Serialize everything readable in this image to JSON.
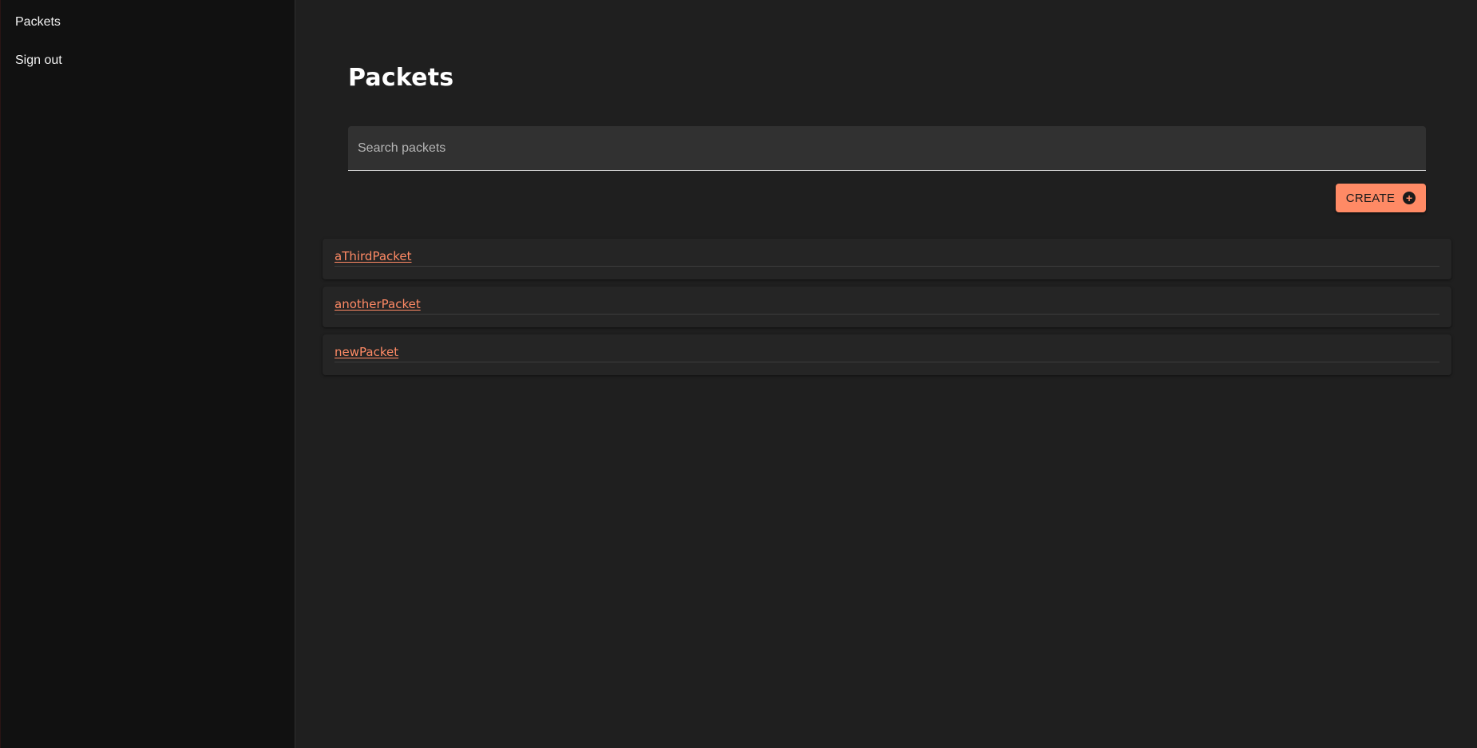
{
  "sidebar": {
    "items": [
      {
        "label": "Packets"
      },
      {
        "label": "Sign out"
      }
    ]
  },
  "main": {
    "title": "Packets",
    "search": {
      "placeholder": "Search packets",
      "value": ""
    },
    "create_button": {
      "label": "CREATE",
      "icon": "plus-circle-icon"
    },
    "packets": [
      {
        "name": "aThirdPacket"
      },
      {
        "name": "anotherPacket"
      },
      {
        "name": "newPacket"
      }
    ]
  },
  "colors": {
    "accent": "#ff8a65",
    "background": "#1f1f1f",
    "sidebar": "#111111",
    "card": "#252525"
  }
}
